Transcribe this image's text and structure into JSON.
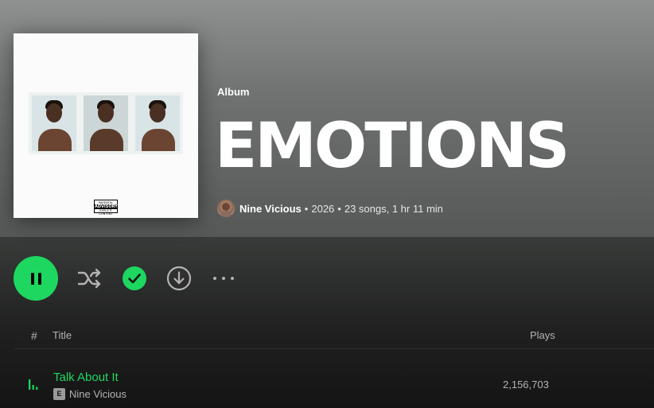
{
  "album": {
    "type_label": "Album",
    "title": "EMOTIONS",
    "artist": "Nine Vicious",
    "separator": "•",
    "year": "2026",
    "stats": "23 songs, 1 hr 11 min",
    "advisory_top": "PARENTAL",
    "advisory_main": "ADVISORY",
    "advisory_bottom": "EXPLICIT CONTENT"
  },
  "controls": {
    "state": "playing",
    "saved": true
  },
  "table": {
    "headers": {
      "number": "#",
      "title": "Title",
      "plays": "Plays"
    }
  },
  "tracks": [
    {
      "title": "Talk About It",
      "artist": "Nine Vicious",
      "explicit_label": "E",
      "plays": "2,156,703",
      "playing": true
    }
  ],
  "colors": {
    "accent": "#1ed760",
    "background": "#121212",
    "secondary_text": "#b3b3b3",
    "hero_top": "#8e918f"
  },
  "icons": {
    "pause": "pause-icon",
    "shuffle": "shuffle-icon",
    "saved": "check-circle-icon",
    "download": "download-icon",
    "more": "more-icon",
    "playing": "equalizer-icon"
  }
}
